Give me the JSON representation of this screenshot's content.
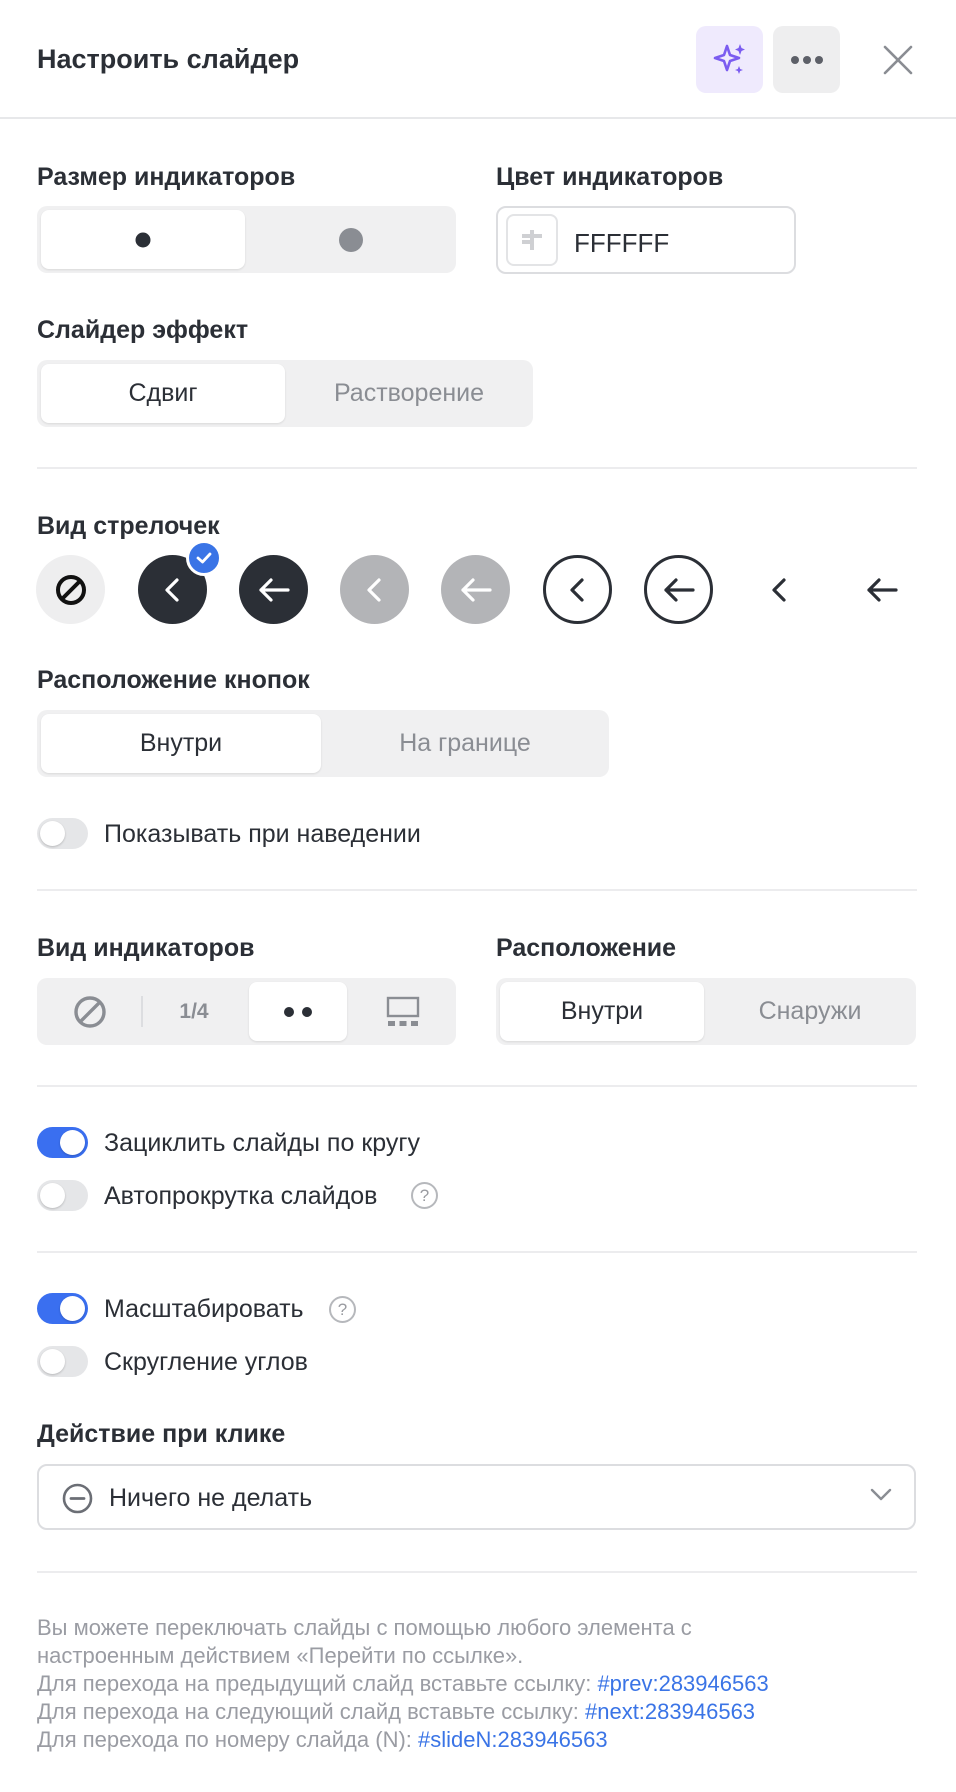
{
  "header": {
    "title": "Настроить слайдер",
    "ai_icon": "sparkles-icon",
    "more_icon": "more-dots-icon",
    "close_icon": "close-icon"
  },
  "indicator_size": {
    "label": "Размер индикаторов",
    "options": [
      "small-dot",
      "large-dot"
    ],
    "selected": "small-dot"
  },
  "indicator_color": {
    "label": "Цвет индикаторов",
    "value": "FFFFFF",
    "swatch_color": "#FFFFFF"
  },
  "slider_effect": {
    "label": "Слайдер эффект",
    "options": [
      "Сдвиг",
      "Растворение"
    ],
    "selected": "Сдвиг"
  },
  "arrow_style": {
    "label": "Вид стрелочек",
    "options": [
      "none",
      "filled-dark-chevron",
      "filled-dark-arrow",
      "filled-gray-chevron",
      "filled-gray-arrow",
      "outline-chevron",
      "outline-arrow",
      "plain-chevron",
      "plain-arrow"
    ],
    "selected": "filled-dark-chevron"
  },
  "button_position": {
    "label": "Расположение кнопок",
    "options": [
      "Внутри",
      "На границе"
    ],
    "selected": "Внутри"
  },
  "show_on_hover": {
    "label": "Показывать при наведении",
    "on": false
  },
  "indicator_type": {
    "label": "Вид индикаторов",
    "options": [
      "none",
      "1/4",
      "dots",
      "thumbnails"
    ],
    "fraction_label": "1/4",
    "selected": "dots"
  },
  "indicator_position": {
    "label": "Расположение",
    "options": [
      "Внутри",
      "Снаружи"
    ],
    "selected": "Внутри"
  },
  "loop": {
    "label": "Зациклить слайды по кругу",
    "on": true
  },
  "autoplay": {
    "label": "Автопрокрутка слайдов",
    "on": false,
    "help": "?"
  },
  "scale": {
    "label": "Масштабировать",
    "on": true,
    "help": "?"
  },
  "rounded": {
    "label": "Скругление углов",
    "on": false
  },
  "click_action": {
    "label": "Действие при клике",
    "value": "Ничего не делать",
    "icon": "minus-circle-icon"
  },
  "note": {
    "line1": "Вы можете переключать слайды с помощью любого элемента с",
    "line2": "настроенным действием «Перейти по ссылке».",
    "prev_text": "Для перехода на предыдущий слайд вставьте ссылку: ",
    "prev_link": "#prev:283946563",
    "next_text": "Для перехода на следующий слайд вставьте ссылку: ",
    "next_link": "#next:283946563",
    "slide_text": "Для перехода по номеру слайда (N): ",
    "slide_link": "#slideN:283946563"
  },
  "colors": {
    "accent": "#3A74E6",
    "toggle_on": "#3A6FF0",
    "ai_purple": "#7B5CF0",
    "dark_button": "#2B2F36",
    "gray_button": "#B3B4B7"
  }
}
